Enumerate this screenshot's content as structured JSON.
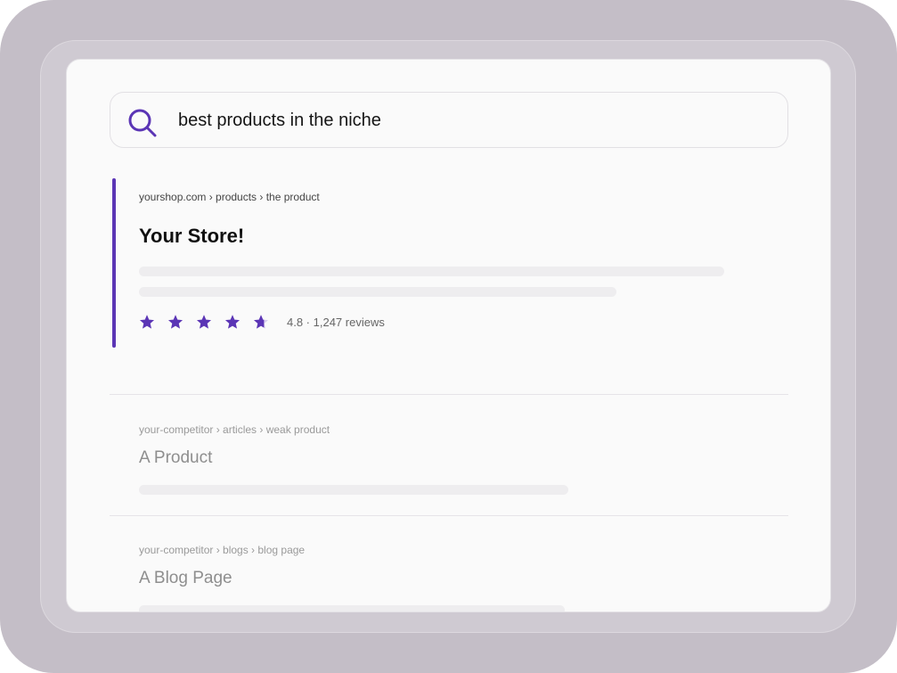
{
  "search": {
    "query": "best products in the niche",
    "icon": "search-icon"
  },
  "featured_result": {
    "breadcrumb": "yourshop.com › products › the product",
    "title": "Your Store!",
    "rating": 4.8,
    "rating_text": "4.8 · 1,247 reviews",
    "stars_total": 5
  },
  "results": [
    {
      "breadcrumb": "your-competitor › articles › weak product",
      "title": "A Product"
    },
    {
      "breadcrumb": "your-competitor › blogs › blog page",
      "title": "A Blog Page"
    }
  ],
  "colors": {
    "accent": "#5b35b5",
    "star_empty": "#d9cdef",
    "frame_outer": "#c4bec7",
    "frame_inner": "#cfcad2",
    "screen_bg": "#fafafa"
  }
}
